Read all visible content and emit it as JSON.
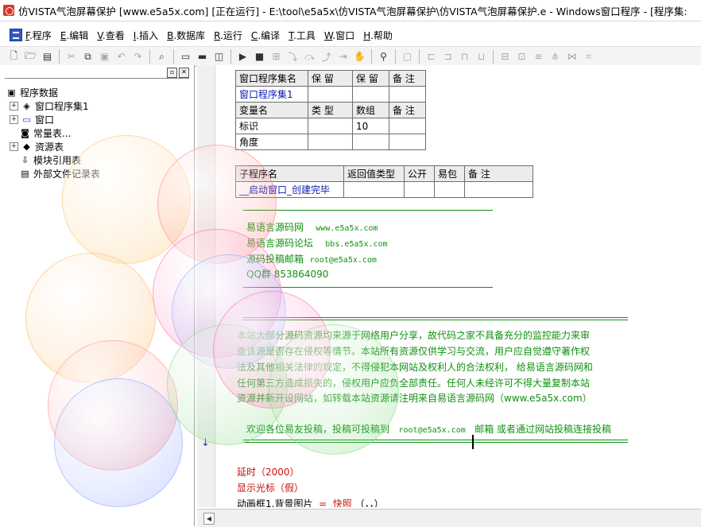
{
  "window": {
    "title": "仿VISTA气泡屏幕保护 [www.e5a5x.com] [正在运行] - E:\\tool\\e5a5x\\仿VISTA气泡屏幕保护\\仿VISTA气泡屏幕保护.e - Windows窗口程序 - [程序集:"
  },
  "menu": [
    {
      "key": "F",
      "label": ".程序"
    },
    {
      "key": "E",
      "label": ".编辑"
    },
    {
      "key": "V",
      "label": ".查看"
    },
    {
      "key": "I",
      "label": ".插入"
    },
    {
      "key": "B",
      "label": ".数据库"
    },
    {
      "key": "R",
      "label": ".运行"
    },
    {
      "key": "C",
      "label": ".编译"
    },
    {
      "key": "T",
      "label": ".工具"
    },
    {
      "key": "W",
      "label": ".窗口"
    },
    {
      "key": "H",
      "label": ".帮助"
    }
  ],
  "toolbar_icons": [
    "new-file-icon",
    "open-folder-icon",
    "save-icon",
    "cut-icon",
    "copy-icon",
    "paste-icon",
    "undo-icon",
    "redo-icon",
    "find-icon",
    "window-layout-icon",
    "tab-layout-icon",
    "split-layout-icon",
    "run-icon",
    "stop-icon",
    "step-icon",
    "step-into-icon",
    "step-over-icon",
    "step-out-icon",
    "run-to-cursor-icon",
    "hand-icon",
    "search-binoculars-icon",
    "form-designer-icon",
    "align-icons"
  ],
  "tree": {
    "root": "程序数据",
    "items": [
      {
        "label": "窗口程序集1",
        "icon": "module-icon",
        "expander": true
      },
      {
        "label": "窗口",
        "icon": "window-icon",
        "expander": true
      },
      {
        "label": "常量表...",
        "icon": "constant-icon",
        "expander": false
      },
      {
        "label": "资源表",
        "icon": "resource-icon",
        "expander": true
      },
      {
        "label": "模块引用表",
        "icon": "module-reference-icon",
        "expander": false
      },
      {
        "label": "外部文件记录表",
        "icon": "external-file-icon",
        "expander": false
      }
    ]
  },
  "program_set_table": {
    "headers": [
      "窗口程序集名",
      "保 留",
      "保 留",
      "备 注"
    ],
    "row": [
      "窗口程序集1",
      "",
      "",
      ""
    ],
    "var_headers": [
      "变量名",
      "类 型",
      "数组",
      "备 注"
    ],
    "vars": [
      [
        "标识",
        "",
        "10",
        ""
      ],
      [
        "角度",
        "",
        "",
        ""
      ]
    ]
  },
  "sub_table": {
    "headers": [
      "子程序名",
      "返回值类型",
      "公开",
      "易包",
      "备 注"
    ],
    "row": [
      "__启动窗口_创建完毕",
      "",
      "",
      "",
      ""
    ]
  },
  "comments": {
    "site1": "易语言源码网",
    "site1_url": "www.e5a5x.com",
    "site2": "易语言源码论坛",
    "site2_url": "bbs.e5a5x.com",
    "mail": "源码投稿邮箱",
    "mail_addr": "root@e5a5x.com",
    "qq": "QQ群   853864090",
    "notice": [
      "本站大部分源码资源均来源于网络用户分享，故代码之家不具备充分的监控能力来审",
      "查该源是否存在侵权等情节。本站所有资源仅供学习与交流，用户应自觉遵守著作权",
      "法及其他相关法律的规定，不得侵犯本网站及权利人的合法权利， 给易语言源码网和",
      "任何第三方造成损失的，侵权用户应负全部责任。任何人未经许可不得大量复制本站",
      "资源并新开设网站，如转载本站资源请注明来自易语言源码网（www.e5a5x.com）"
    ],
    "welcome": "欢迎各位易友投稿，投稿可投稿到",
    "welcome_mail": "root@e5a5x.com",
    "welcome_tail": "邮箱 或者通过网站投稿连接投稿"
  },
  "code": {
    "line1": "延时（2000）",
    "line2": "显示光标（假）",
    "line3_obj": "动画框1.背景图片",
    "line3_eq": "=",
    "line3_fn": "快照",
    "line3_args": "（，，）"
  },
  "colors": {
    "keyword_red": "#c81010",
    "comment_green": "#109010",
    "identifier_blue": "#0a1ab4"
  }
}
